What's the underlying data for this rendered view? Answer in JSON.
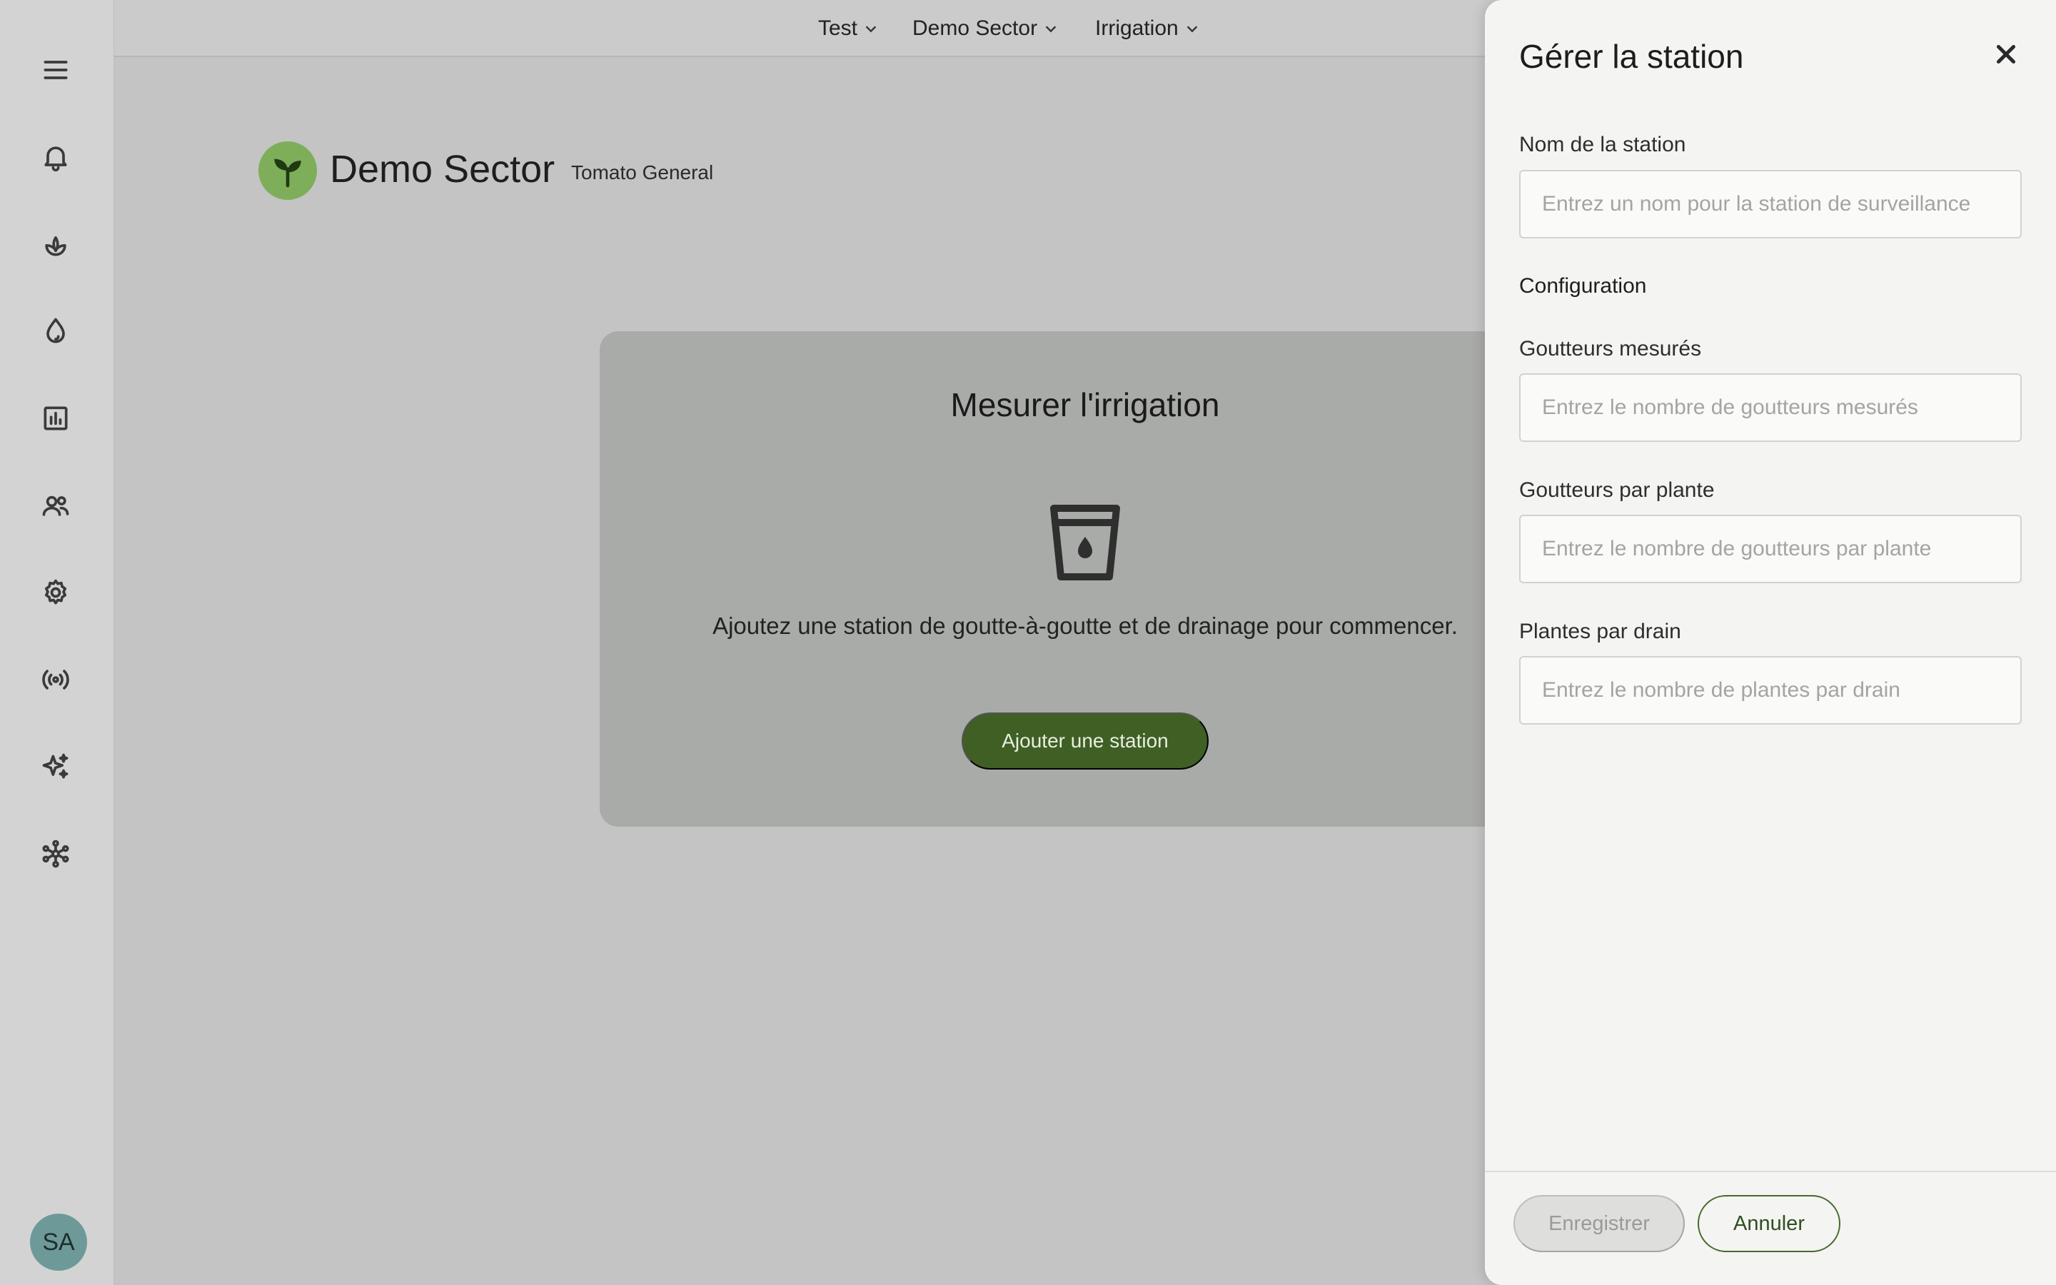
{
  "breadcrumbs": [
    {
      "label": "Test"
    },
    {
      "label": "Demo Sector"
    },
    {
      "label": "Irrigation"
    }
  ],
  "user": {
    "initials": "SA"
  },
  "sector": {
    "title": "Demo Sector",
    "subtitle": "Tomato General"
  },
  "card": {
    "title": "Mesurer l'irrigation",
    "description": "Ajoutez une station de goutte-à-goutte et de drainage pour commencer.",
    "button": "Ajouter une station"
  },
  "drawer": {
    "title": "Gérer la station",
    "name_label": "Nom de la station",
    "name_placeholder": "Entrez un nom pour la station de surveillance",
    "config_label": "Configuration",
    "drippers_label": "Goutteurs mesurés",
    "drippers_placeholder": "Entrez le nombre de goutteurs mesurés",
    "per_plant_label": "Goutteurs par plante",
    "per_plant_placeholder": "Entrez le nombre de goutteurs par plante",
    "plants_drain_label": "Plantes par drain",
    "plants_drain_placeholder": "Entrez le nombre de plantes par drain",
    "save": "Enregistrer",
    "cancel": "Annuler"
  },
  "colors": {
    "primary": "#3f5f25",
    "logo_bg": "#7fae5a",
    "avatar_bg": "#6d9a98"
  },
  "icons": [
    "menu-icon",
    "bell-icon",
    "sprout-icon",
    "drop-icon",
    "chart-icon",
    "users-icon",
    "gear-icon",
    "antenna-icon",
    "sparkles-icon",
    "network-icon",
    "close-icon",
    "chevron-down-icon",
    "cup-drop-icon"
  ]
}
